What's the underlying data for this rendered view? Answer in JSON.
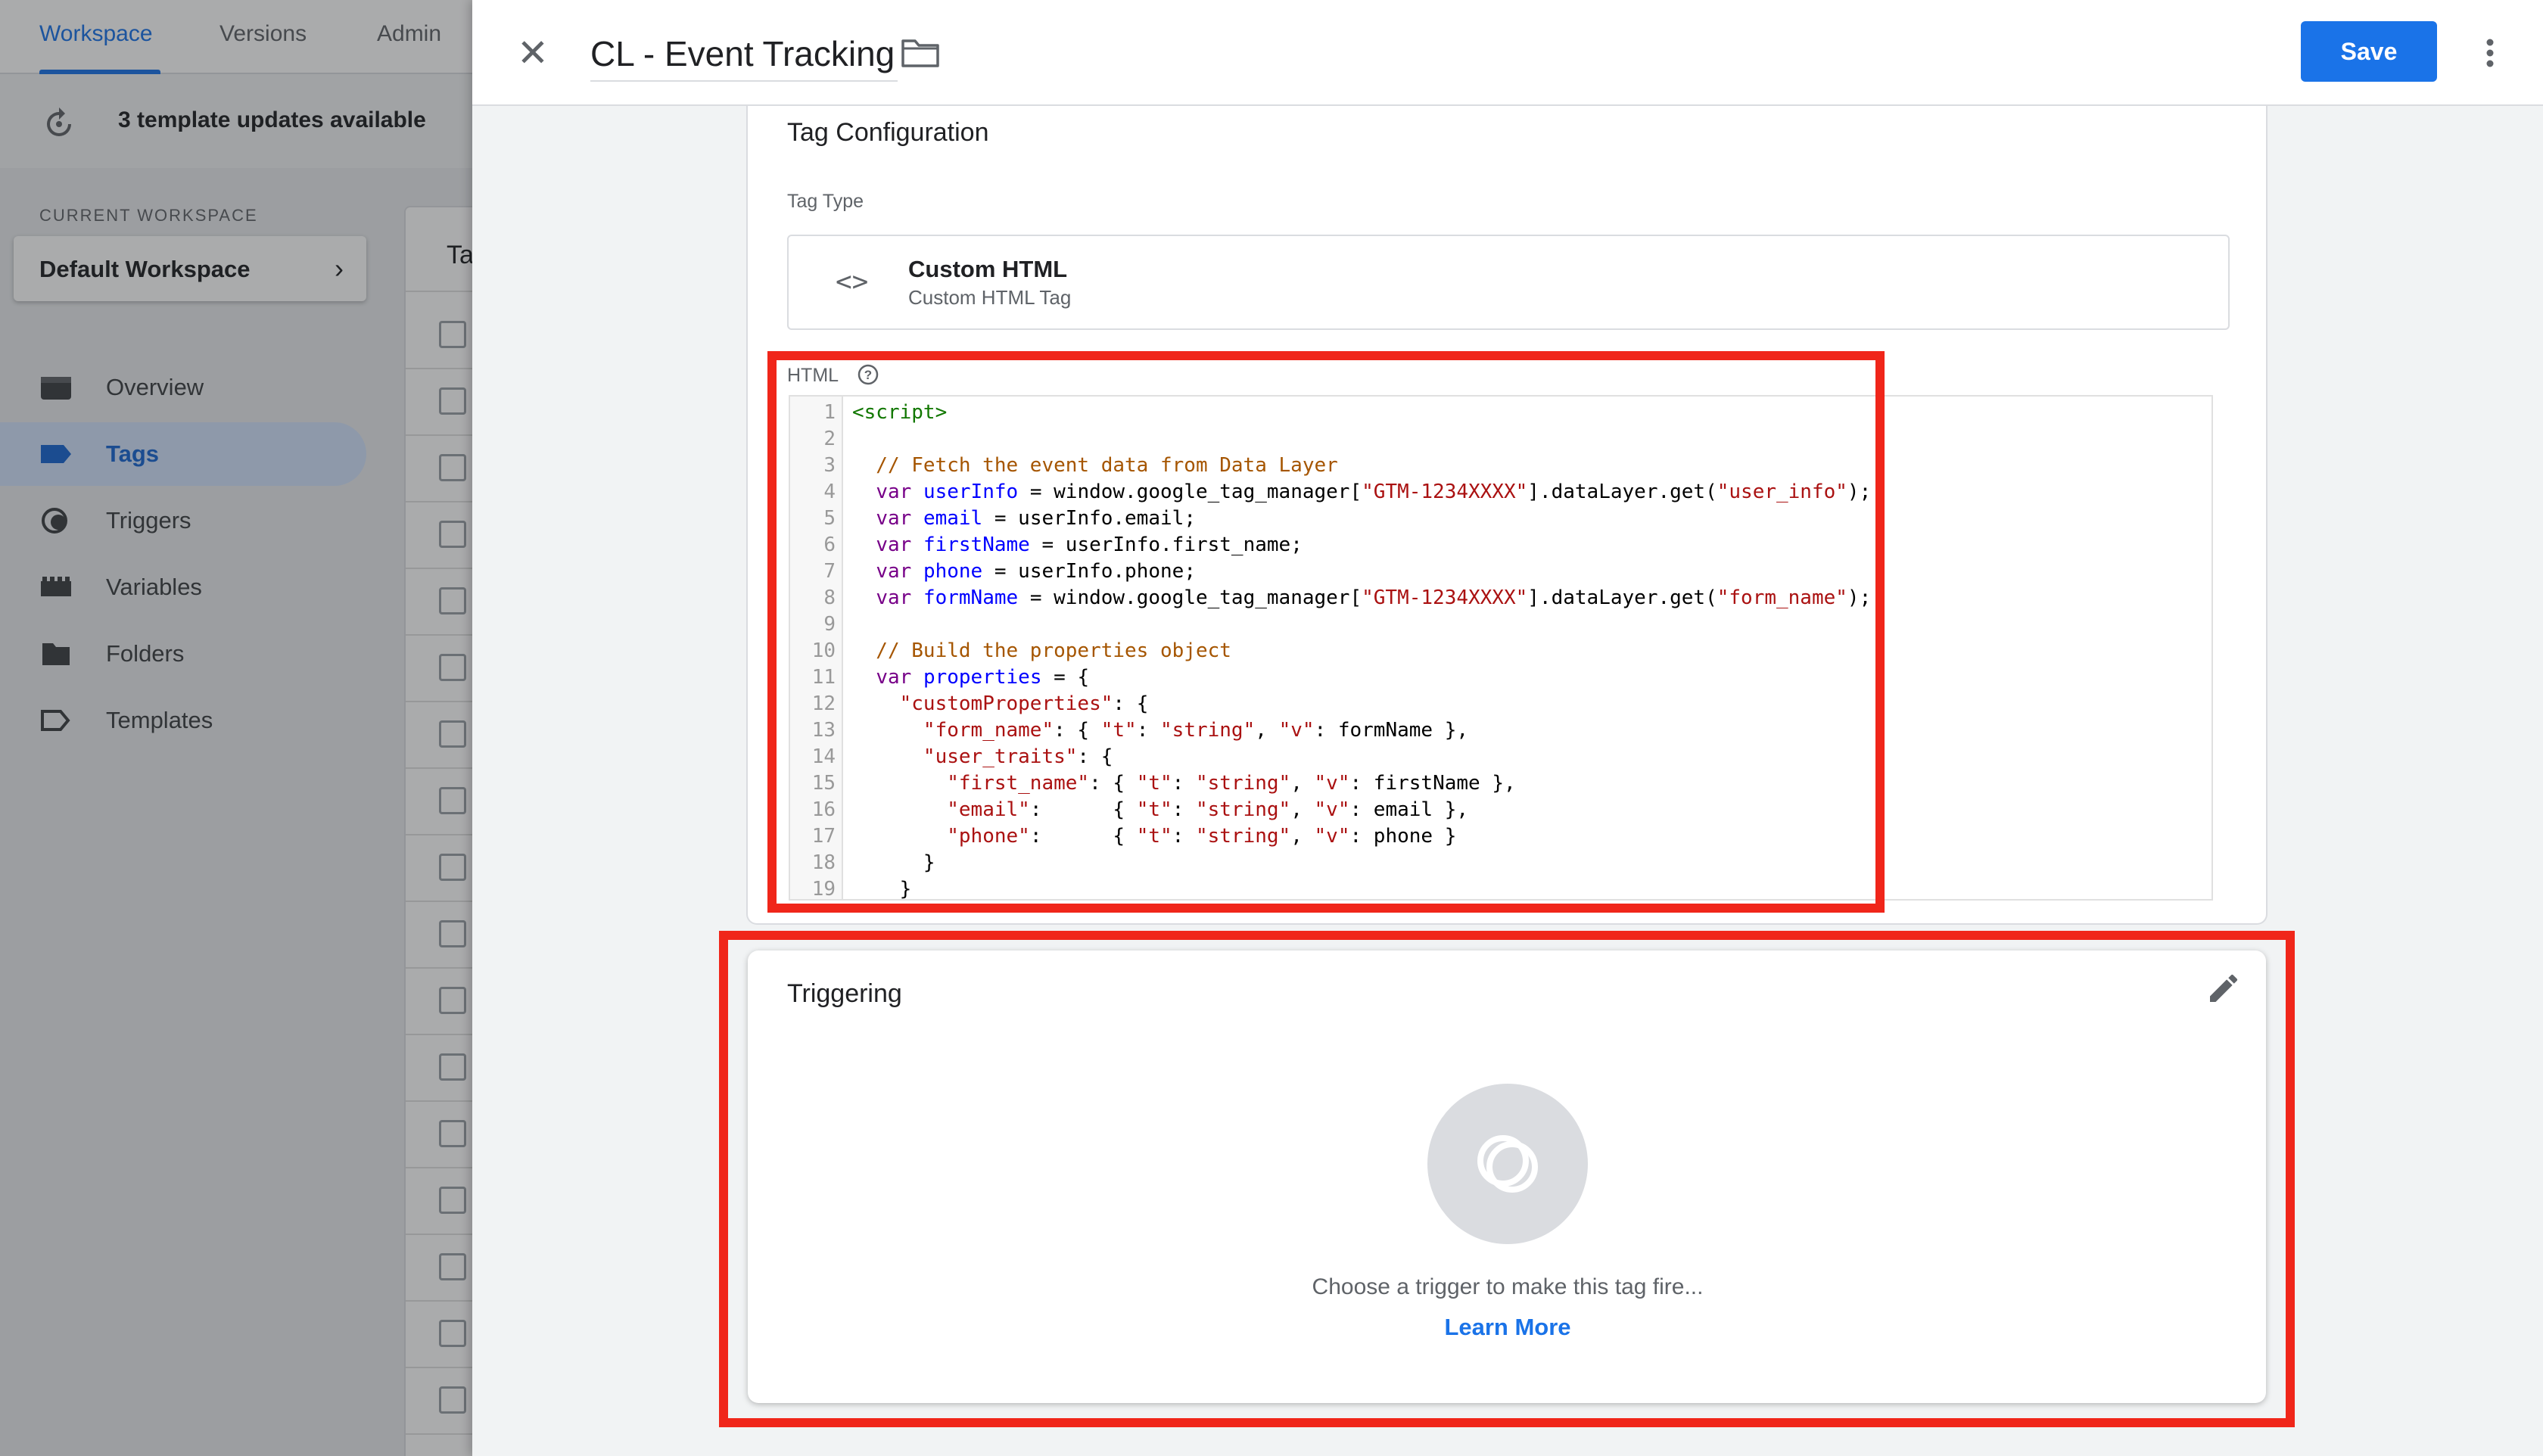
{
  "nav_tabs": [
    "Workspace",
    "Versions",
    "Admin"
  ],
  "updates_text": "3 template updates available",
  "current_workspace_label": "CURRENT WORKSPACE",
  "workspace_name": "Default Workspace",
  "sidebar": [
    {
      "label": "Overview",
      "icon": "overview-icon"
    },
    {
      "label": "Tags",
      "icon": "tag-icon",
      "active": true
    },
    {
      "label": "Triggers",
      "icon": "trigger-icon"
    },
    {
      "label": "Variables",
      "icon": "variables-icon"
    },
    {
      "label": "Folders",
      "icon": "folder-icon"
    },
    {
      "label": "Templates",
      "icon": "template-icon"
    }
  ],
  "tags_table_header_partial": "Ta",
  "editor": {
    "title": "CL - Event Tracking",
    "save_label": "Save",
    "config_title": "Tag Configuration",
    "tag_type_label": "Tag Type",
    "tag_type_name": "Custom HTML",
    "tag_type_sub": "Custom HTML Tag",
    "html_label": "HTML",
    "code_lines": [
      "<script>",
      "",
      "  // Fetch the event data from Data Layer",
      "  var userInfo = window.google_tag_manager[\"GTM-1234XXXX\"].dataLayer.get(\"user_info\");",
      "  var email = userInfo.email;",
      "  var firstName = userInfo.first_name;",
      "  var phone = userInfo.phone;",
      "  var formName = window.google_tag_manager[\"GTM-1234XXXX\"].dataLayer.get(\"form_name\");",
      "",
      "  // Build the properties object",
      "  var properties = {",
      "    \"customProperties\": {",
      "      \"form_name\": { \"t\": \"string\", \"v\": formName },",
      "      \"user_traits\": {",
      "        \"first_name\": { \"t\": \"string\", \"v\": firstName },",
      "        \"email\":      { \"t\": \"string\", \"v\": email },",
      "        \"phone\":      { \"t\": \"string\", \"v\": phone }",
      "      }",
      "    }"
    ],
    "triggering_title": "Triggering",
    "trigger_empty_text": "Choose a trigger to make this tag fire...",
    "learn_more": "Learn More"
  },
  "colors": {
    "accent": "#1a73e8",
    "annotation_red": "#f0261a"
  }
}
